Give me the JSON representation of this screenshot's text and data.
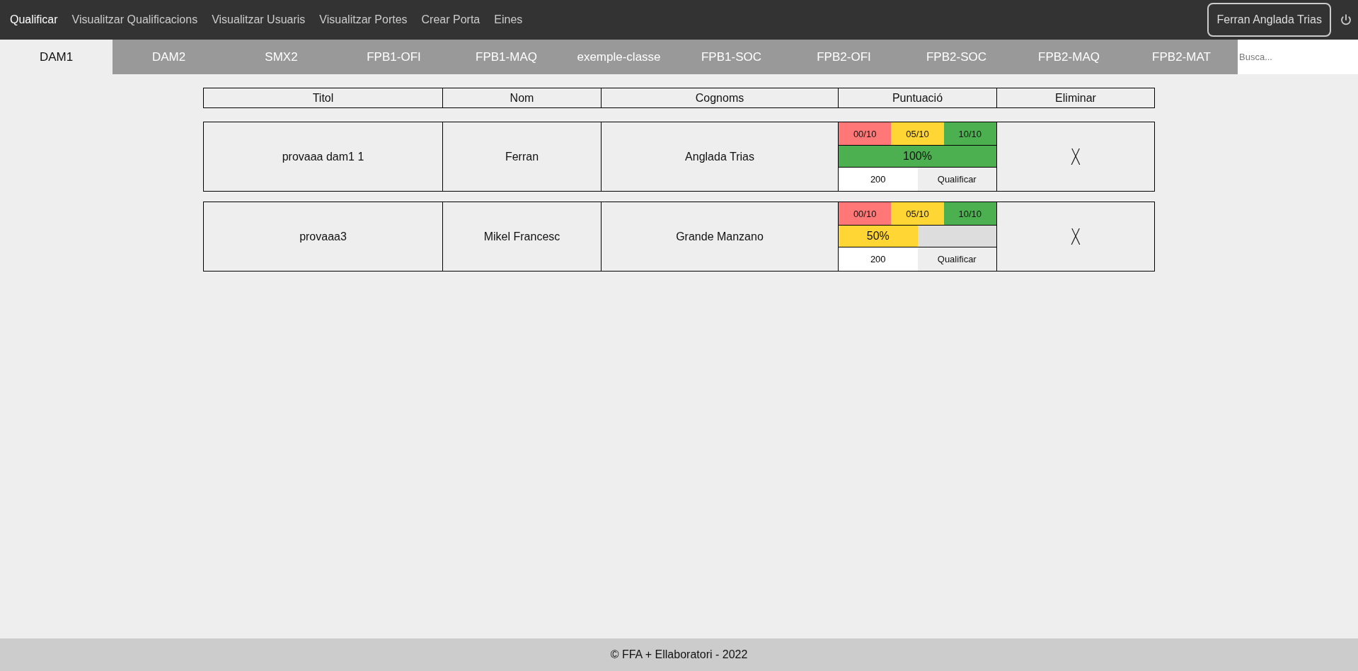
{
  "nav": {
    "items": [
      {
        "label": "Qualificar",
        "selected": true
      },
      {
        "label": "Visualitzar Qualificacions",
        "selected": false
      },
      {
        "label": "Visualitzar Usuaris",
        "selected": false
      },
      {
        "label": "Visualitzar Portes",
        "selected": false
      },
      {
        "label": "Crear Porta",
        "selected": false
      },
      {
        "label": "Eines",
        "selected": false
      }
    ],
    "user": "Ferran Anglada Trias"
  },
  "tabs": [
    {
      "label": "DAM1",
      "selected": true
    },
    {
      "label": "DAM2",
      "selected": false
    },
    {
      "label": "SMX2",
      "selected": false
    },
    {
      "label": "FPB1-OFI",
      "selected": false
    },
    {
      "label": "FPB1-MAQ",
      "selected": false
    },
    {
      "label": "exemple-classe",
      "selected": false
    },
    {
      "label": "FPB1-SOC",
      "selected": false
    },
    {
      "label": "FPB2-OFI",
      "selected": false
    },
    {
      "label": "FPB2-SOC",
      "selected": false
    },
    {
      "label": "FPB2-MAQ",
      "selected": false
    },
    {
      "label": "FPB2-MAT",
      "selected": false
    }
  ],
  "search": {
    "placeholder": "Busca..."
  },
  "table": {
    "columns": [
      "Titol",
      "Nom",
      "Cognoms",
      "Puntuació",
      "Eliminar"
    ],
    "rows": [
      {
        "titol": "provaaa dam1 1",
        "nom": "Ferran",
        "cognoms": "Anglada Trias",
        "grades": [
          {
            "label": "00/10",
            "color": "#ff7777"
          },
          {
            "label": "05/10",
            "color": "#ffd633"
          },
          {
            "label": "10/10",
            "color": "#4caf50"
          }
        ],
        "level": 1.0,
        "reading": "100%",
        "score": "200",
        "button": "Qualificar",
        "delete": "X"
      },
      {
        "titol": "provaaa3",
        "nom": "Mikel Francesc",
        "cognoms": "Grande Manzano",
        "grades": [
          {
            "label": "00/10",
            "color": "#ff7777"
          },
          {
            "label": "05/10",
            "color": "#ffd633"
          },
          {
            "label": "10/10",
            "color": "#4caf50"
          }
        ],
        "level": 0.5,
        "reading": "50%",
        "score": "200",
        "button": "Qualificar",
        "delete": "X"
      }
    ]
  },
  "footer": "© FFA + Ellaboratori - 2022"
}
